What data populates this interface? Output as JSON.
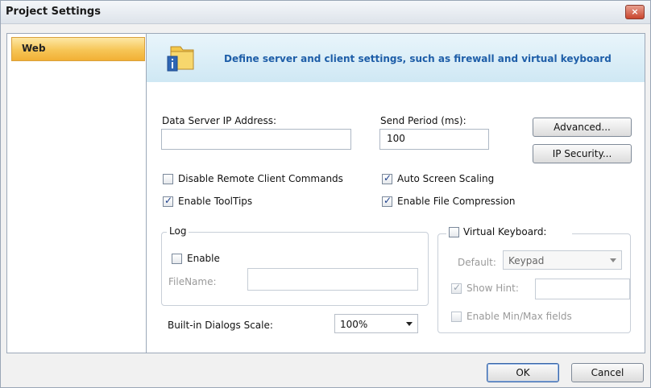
{
  "window": {
    "title": "Project Settings",
    "close_glyph": "×"
  },
  "sidebar": {
    "items": [
      {
        "label": "Web",
        "selected": true
      }
    ]
  },
  "banner": {
    "text": "Define server and  client settings, such as firewall and virtual keyboard",
    "icon": "folder-info-icon"
  },
  "fields": {
    "data_server_ip_label": "Data Server IP Address:",
    "data_server_ip_value": "",
    "send_period_label": "Send Period (ms):",
    "send_period_value": "100"
  },
  "buttons": {
    "advanced": "Advanced...",
    "ip_security": "IP Security...",
    "ok": "OK",
    "cancel": "Cancel"
  },
  "checkboxes": {
    "disable_remote": {
      "label": "Disable Remote Client Commands",
      "checked": false
    },
    "enable_tooltips": {
      "label": "Enable ToolTips",
      "checked": true
    },
    "auto_screen_scaling": {
      "label": "Auto Screen Scaling",
      "checked": true
    },
    "enable_file_compression": {
      "label": "Enable File Compression",
      "checked": true
    }
  },
  "log": {
    "legend": "Log",
    "enable_label": "Enable",
    "enable_checked": false,
    "filename_label": "FileName:",
    "filename_value": ""
  },
  "dialogs_scale": {
    "label": "Built-in Dialogs Scale:",
    "value": "100%"
  },
  "virtual_keyboard": {
    "label": "Virtual Keyboard:",
    "checked": false,
    "default_label": "Default:",
    "default_value": "Keypad",
    "show_hint_label": "Show Hint:",
    "show_hint_checked": true,
    "show_hint_value": "",
    "min_max_label": "Enable Min/Max fields",
    "min_max_checked": false
  }
}
